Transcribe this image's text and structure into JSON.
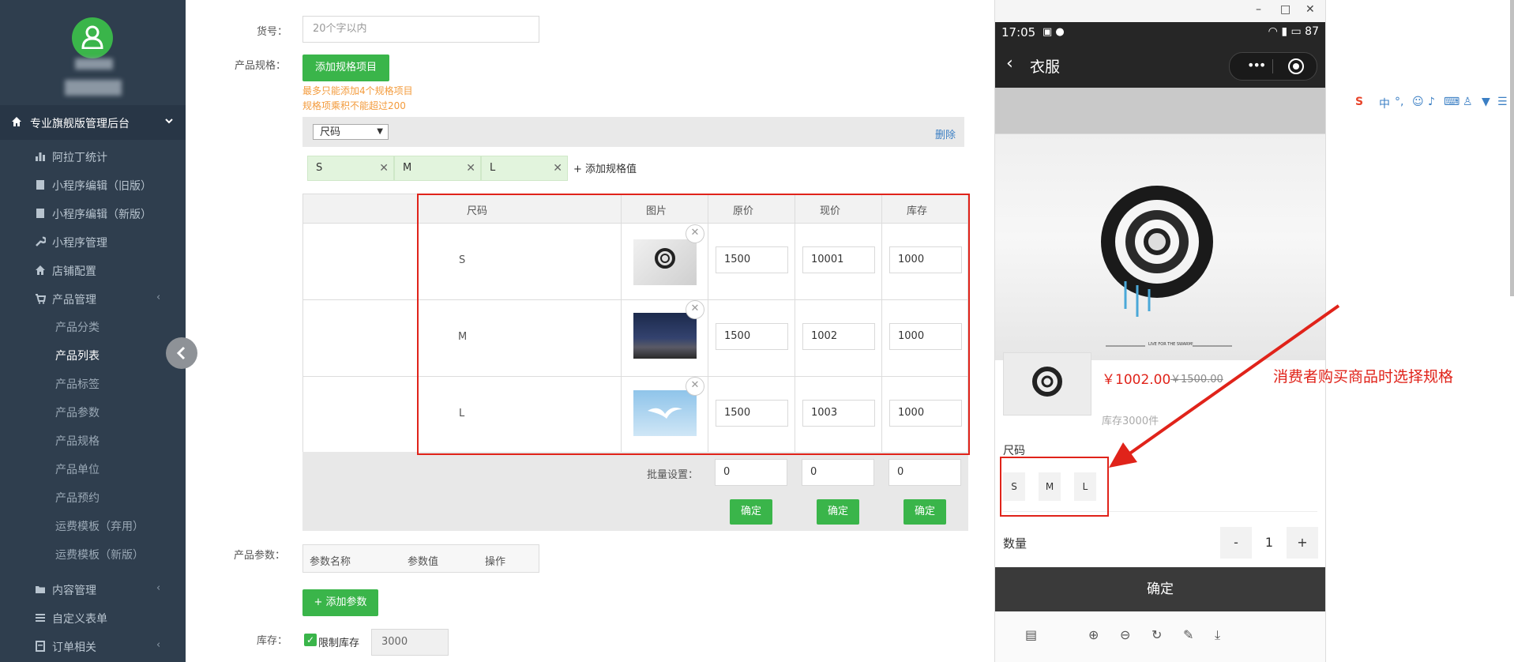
{
  "sidebar": {
    "header": "专业旗舰版管理后台",
    "items": [
      {
        "label": "阿拉丁统计",
        "icon": "bar-chart-icon"
      },
      {
        "label": "小程序编辑（旧版）",
        "icon": "book-icon"
      },
      {
        "label": "小程序编辑（新版）",
        "icon": "book-icon"
      },
      {
        "label": "小程序管理",
        "icon": "wrench-icon"
      },
      {
        "label": "店铺配置",
        "icon": "home-icon"
      },
      {
        "label": "产品管理",
        "icon": "cart-icon"
      }
    ],
    "sub_items": [
      "产品分类",
      "产品列表",
      "产品标签",
      "产品参数",
      "产品规格",
      "产品单位",
      "产品预约",
      "运费模板（弃用）",
      "运费模板（新版）"
    ],
    "bottom_items": [
      {
        "label": "内容管理",
        "icon": "folder-icon"
      },
      {
        "label": "自定义表单",
        "icon": "list-icon"
      },
      {
        "label": "订单相关",
        "icon": "order-icon"
      }
    ],
    "arrow": "‹"
  },
  "form": {
    "sku_label": "货号：",
    "sku_placeholder": "20个字以内",
    "spec_label": "产品规格：",
    "add_spec_button": "添加规格项目",
    "hint1": "最多只能添加4个规格项目",
    "hint2": "规格项乘积不能超过200",
    "spec_select": "尺码",
    "delete_link": "删除",
    "chips": [
      "S",
      "M",
      "L"
    ],
    "add_value": "+ 添加规格值",
    "table_headers": [
      "尺码",
      "图片",
      "原价",
      "现价",
      "库存"
    ],
    "rows": [
      {
        "size": "S",
        "orig": "1500",
        "now": "10001",
        "stock": "1000"
      },
      {
        "size": "M",
        "orig": "1500",
        "now": "1002",
        "stock": "1000"
      },
      {
        "size": "L",
        "orig": "1500",
        "now": "1003",
        "stock": "1000"
      }
    ],
    "batch_label": "批量设置：",
    "batch_values": [
      "0",
      "0",
      "0"
    ],
    "confirm": "确定",
    "param_label": "产品参数：",
    "param_headers": [
      "参数名称",
      "参数值",
      "操作"
    ],
    "add_param_button": "+ 添加参数",
    "stock_label": "库存：",
    "limit_stock": "限制库存",
    "stock_value": "3000"
  },
  "phone": {
    "time": "17:05",
    "battery": "87",
    "title": "衣服",
    "price": "￥1002.00",
    "old_price": "￥1500.00",
    "stock_text": "库存3000件",
    "spec_label": "尺码",
    "spec_options": [
      "S",
      "M",
      "L"
    ],
    "qty_label": "数量",
    "qty_minus": "-",
    "qty_value": "1",
    "qty_plus": "+",
    "confirm": "确定",
    "image_caption": "LIVE FOR THE SWARM!"
  },
  "annotation": "消费者购买商品时选择规格",
  "colors": {
    "accent": "#3ab54a",
    "sidebar": "#2f3e4e",
    "annot": "#e0231a"
  }
}
